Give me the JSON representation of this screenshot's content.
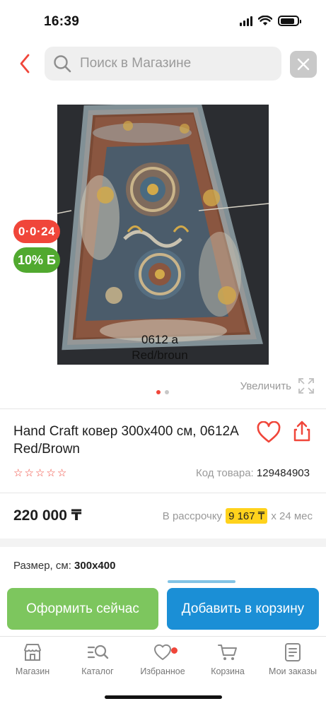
{
  "status_bar": {
    "time": "16:39"
  },
  "search": {
    "placeholder": "Поиск в Магазине"
  },
  "product": {
    "image_caption_line1": "0612 a",
    "image_caption_line2": "Red/broun",
    "timer_badge": "0·0·24",
    "discount_badge": "10% Б",
    "zoom_label": "Увеличить",
    "title": "Hand Craft ковер 300х400 см, 0612A Red/Brown",
    "sku_label": "Код товара:",
    "sku_value": "129484903",
    "price": "220 000 ₸",
    "installment_prefix": "В рассрочку",
    "installment_amount": "9 167 ₸",
    "installment_suffix": "х 24 мес",
    "size_label": "Размер, см:",
    "size_value": "300x400",
    "rating_stars": 0,
    "image_count": 2,
    "active_image": 1
  },
  "actions": {
    "buy_now": "Оформить сейчас",
    "add_to_cart": "Добавить в корзину"
  },
  "tab_bar": {
    "items": [
      {
        "label": "Магазин",
        "icon": "store-icon"
      },
      {
        "label": "Каталог",
        "icon": "catalog-search-icon"
      },
      {
        "label": "Избранное",
        "icon": "heart-icon"
      },
      {
        "label": "Корзина",
        "icon": "cart-icon"
      },
      {
        "label": "Мои заказы",
        "icon": "orders-icon"
      }
    ]
  },
  "colors": {
    "accent_red": "#f0463a",
    "buy_green": "#7dc65e",
    "cart_blue": "#1b8fd6",
    "discount_green": "#51a92f",
    "installment_yellow": "#ffd21c"
  }
}
